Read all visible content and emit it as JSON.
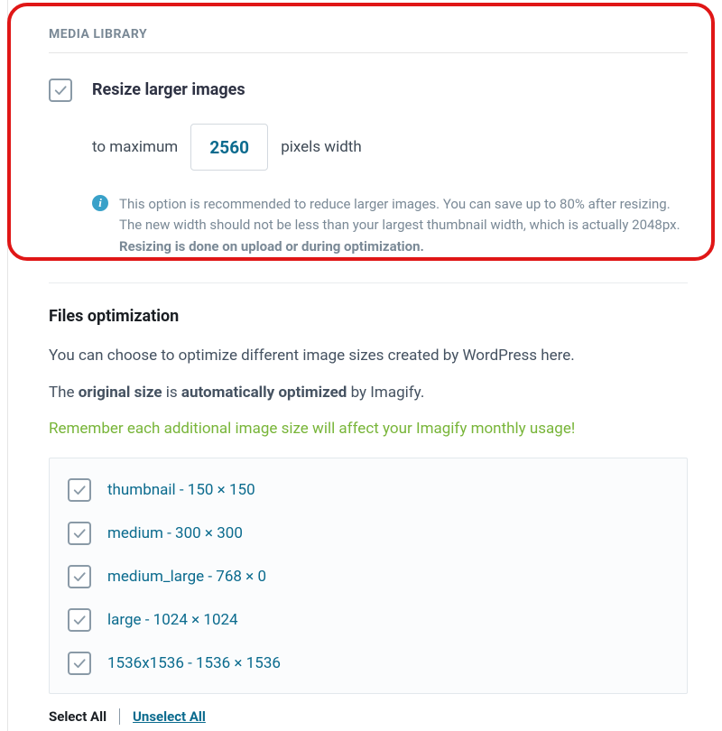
{
  "section_title": "MEDIA LIBRARY",
  "resize": {
    "label": "Resize larger images",
    "prefix": "to maximum",
    "value": "2560",
    "suffix": "pixels width",
    "info_prefix": "This option is recommended to reduce larger images. You can save up to 80% after resizing. The new width should not be less than your largest thumbnail width, which is actually 2048px. ",
    "info_bold": "Resizing is done on upload or during optimization."
  },
  "files": {
    "title": "Files optimization",
    "intro": "You can choose to optimize different image sizes created by WordPress here.",
    "line2_pre": "The ",
    "line2_b1": "original size",
    "line2_mid": " is ",
    "line2_b2": "automatically optimized",
    "line2_post": " by Imagify.",
    "green": "Remember each additional image size will affect your Imagify monthly usage!"
  },
  "sizes": [
    {
      "label": "thumbnail - 150 × 150"
    },
    {
      "label": "medium - 300 × 300"
    },
    {
      "label": "medium_large - 768 × 0"
    },
    {
      "label": "large - 1024 × 1024"
    },
    {
      "label": "1536x1536 - 1536 × 1536"
    }
  ],
  "select_all": "Select All",
  "unselect_all": "Unselect All"
}
